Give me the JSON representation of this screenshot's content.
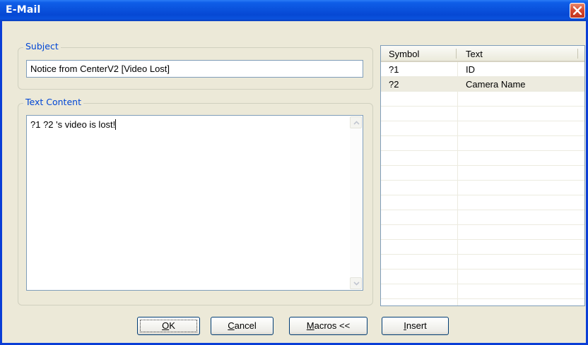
{
  "window": {
    "title": "E-Mail"
  },
  "subject": {
    "legend": "Subject",
    "value": "Notice from CenterV2 [Video Lost]"
  },
  "content": {
    "legend": "Text Content",
    "value": "?1 ?2 's video is lost!"
  },
  "macro_table": {
    "columns": [
      "Symbol",
      "Text"
    ],
    "rows": [
      {
        "symbol": "?1",
        "text": "ID",
        "selected": false
      },
      {
        "symbol": "?2",
        "text": "Camera Name",
        "selected": true
      }
    ]
  },
  "buttons": {
    "ok": {
      "mnemonic": "O",
      "rest": "K"
    },
    "cancel": {
      "mnemonic": "C",
      "rest": "ancel"
    },
    "macros": {
      "mnemonic": "M",
      "rest": "acros <<"
    },
    "insert": {
      "mnemonic": "I",
      "rest": "nsert"
    }
  },
  "icons": {
    "close": "close-icon",
    "scroll_up": "scroll-up-arrow-icon",
    "scroll_down": "scroll-down-arrow-icon"
  },
  "colors": {
    "titlebar": "#0a52dc",
    "legend_text": "#0046d5",
    "close_button": "#d5462c",
    "dialog_bg": "#ece9d8"
  }
}
